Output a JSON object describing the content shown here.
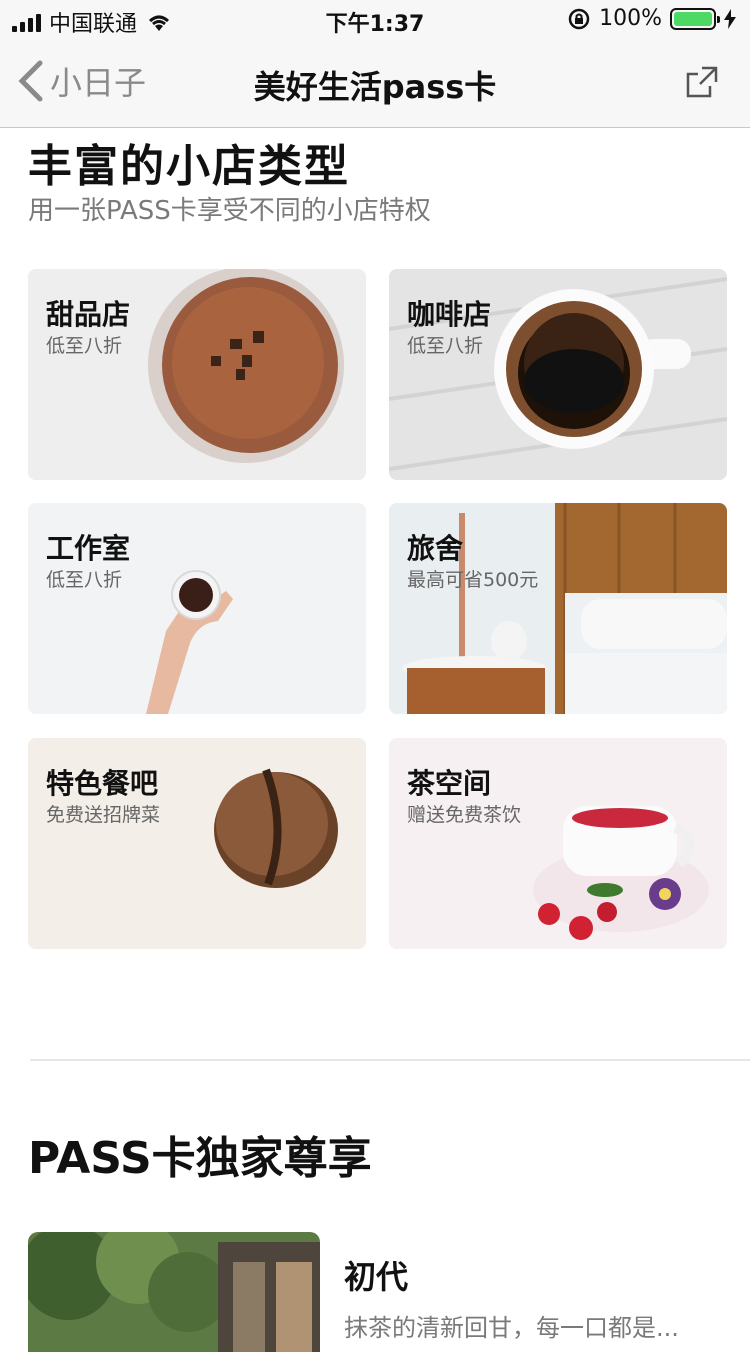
{
  "status": {
    "carrier": "中国联通",
    "time": "下午1:37",
    "battery": "100%",
    "battery_level": 1.0,
    "battery_color": "#4cd964"
  },
  "nav": {
    "back_label": "小日子",
    "title": "美好生活pass卡",
    "share_icon": "share-icon"
  },
  "section1": {
    "title": "丰富的小店类型",
    "subtitle": "用一张PASS卡享受不同的小店特权"
  },
  "cards": [
    {
      "name": "甜品店",
      "desc": "低至八折"
    },
    {
      "name": "咖啡店",
      "desc": "低至八折"
    },
    {
      "name": "工作室",
      "desc": "低至八折"
    },
    {
      "name": "旅舍",
      "desc": "最高可省500元"
    },
    {
      "name": "特色餐吧",
      "desc": "免费送招牌菜"
    },
    {
      "name": "茶空间",
      "desc": "赠送免费茶饮"
    }
  ],
  "section2": {
    "title": "PASS卡独家尊享",
    "item": {
      "name": "初代",
      "desc": "抹茶的清新回甘，每一口都是..."
    }
  }
}
